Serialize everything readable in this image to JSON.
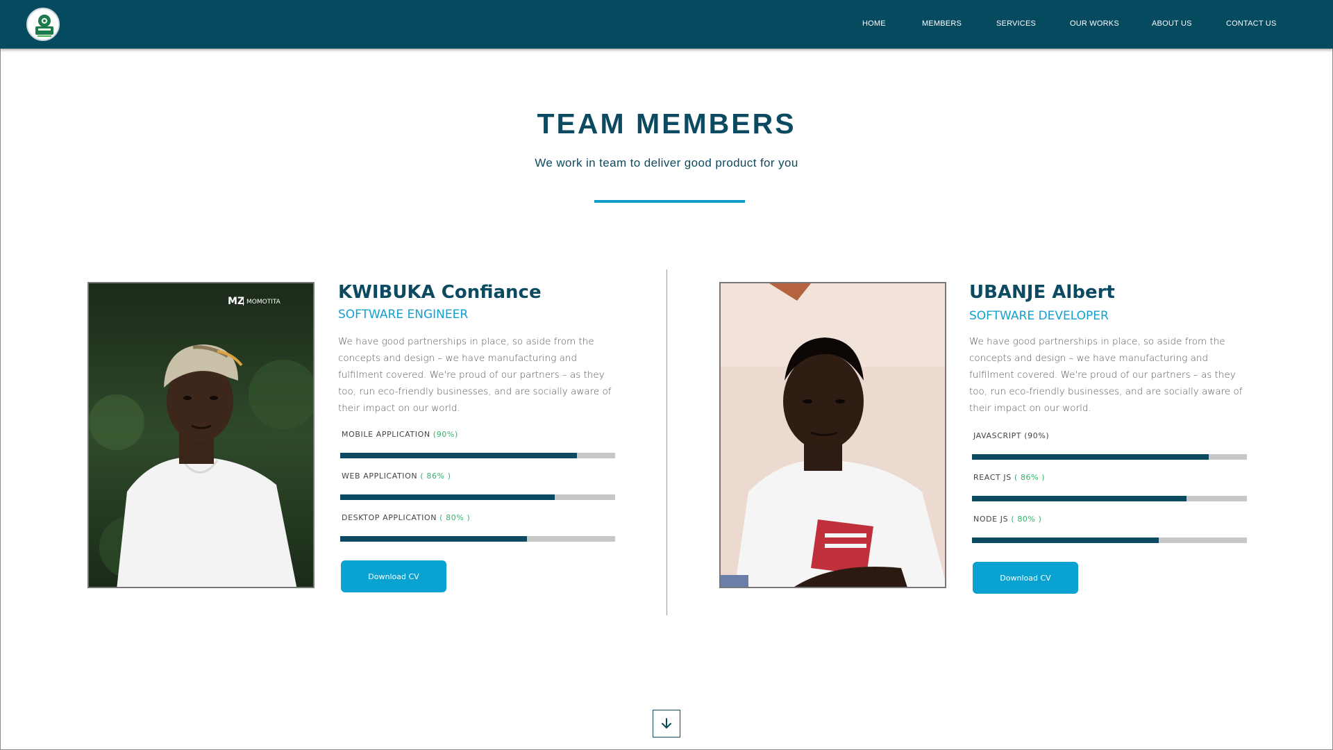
{
  "nav": {
    "items": [
      {
        "label": "HOME"
      },
      {
        "label": "MEMBERS"
      },
      {
        "label": "SERVICES"
      },
      {
        "label": "OUR WORKS"
      },
      {
        "label": "ABOUT US"
      },
      {
        "label": "CONTACT US"
      }
    ]
  },
  "section": {
    "title": "TEAM MEMBERS",
    "subtitle": "We work in team to deliver good product for you"
  },
  "members": [
    {
      "name": "KWIBUKA Confiance",
      "role": "SOFTWARE ENGINEER",
      "description": "We have good partnerships in place, so aside from the concepts and design – we have manufacturing and fulfilment covered. We're proud of our partners – as they too, run eco-friendly businesses, and are socially aware of their impact on our world.",
      "photo_watermark": "MOMOTITA",
      "skills": [
        {
          "label": "MOBILE APPLICATION",
          "pct_text": "(90%)",
          "level": 0.86
        },
        {
          "label": "WEB APPLICATION",
          "pct_text": "( 86% )",
          "level": 0.78
        },
        {
          "label": "DESKTOP APPLICATION",
          "pct_text": "( 80% )",
          "level": 0.68
        }
      ],
      "button": "Download CV"
    },
    {
      "name": "UBANJE Albert",
      "role": "SOFTWARE DEVELOPER",
      "description": "We have good partnerships in place, so aside from the concepts and design – we have manufacturing and fulfilment covered. We're proud of our partners – as they too, run eco-friendly businesses, and are socially aware of their impact on our world.",
      "skills": [
        {
          "label": "JAVASCRIPT",
          "pct_text": "(90%)",
          "level": 0.86
        },
        {
          "label": "REACT JS",
          "pct_text": "( 86% )",
          "level": 0.78
        },
        {
          "label": "NODE JS",
          "pct_text": "( 80% )",
          "level": 0.68
        }
      ],
      "button": "Download CV"
    }
  ],
  "icons": {
    "logo": "logo-icon",
    "scroll": "arrow-down-icon"
  },
  "colors": {
    "nav_bg": "#064a60",
    "accent": "#0aa3d1",
    "heading": "#0b4a60",
    "percent": "#2fb36b"
  }
}
